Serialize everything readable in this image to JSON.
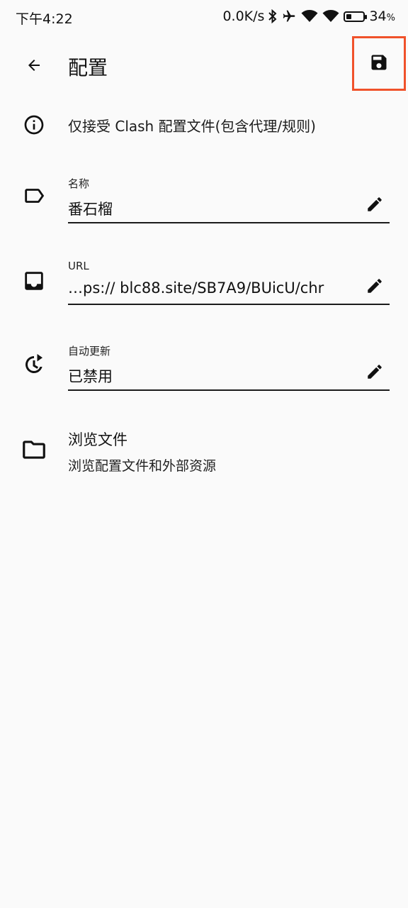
{
  "status_bar": {
    "time": "下午4:22",
    "net_speed": "0.0K/s",
    "battery_level": 0.34,
    "battery_text": "34",
    "battery_unit": "%"
  },
  "app_bar": {
    "title": "配置",
    "back_icon": "arrow-back-icon",
    "save_icon": "save-icon",
    "highlight_color": "#f0522b"
  },
  "info": {
    "text": "仅接受 Clash 配置文件(包含代理/规则)"
  },
  "fields": {
    "name": {
      "label": "名称",
      "value": "番石榴"
    },
    "url": {
      "label": "URL",
      "value": "…ps:// blc88.site/SB7A9/BUicU/chr"
    },
    "auto_update": {
      "label": "自动更新",
      "value": "已禁用"
    }
  },
  "browse": {
    "title": "浏览文件",
    "subtitle": "浏览配置文件和外部资源"
  }
}
